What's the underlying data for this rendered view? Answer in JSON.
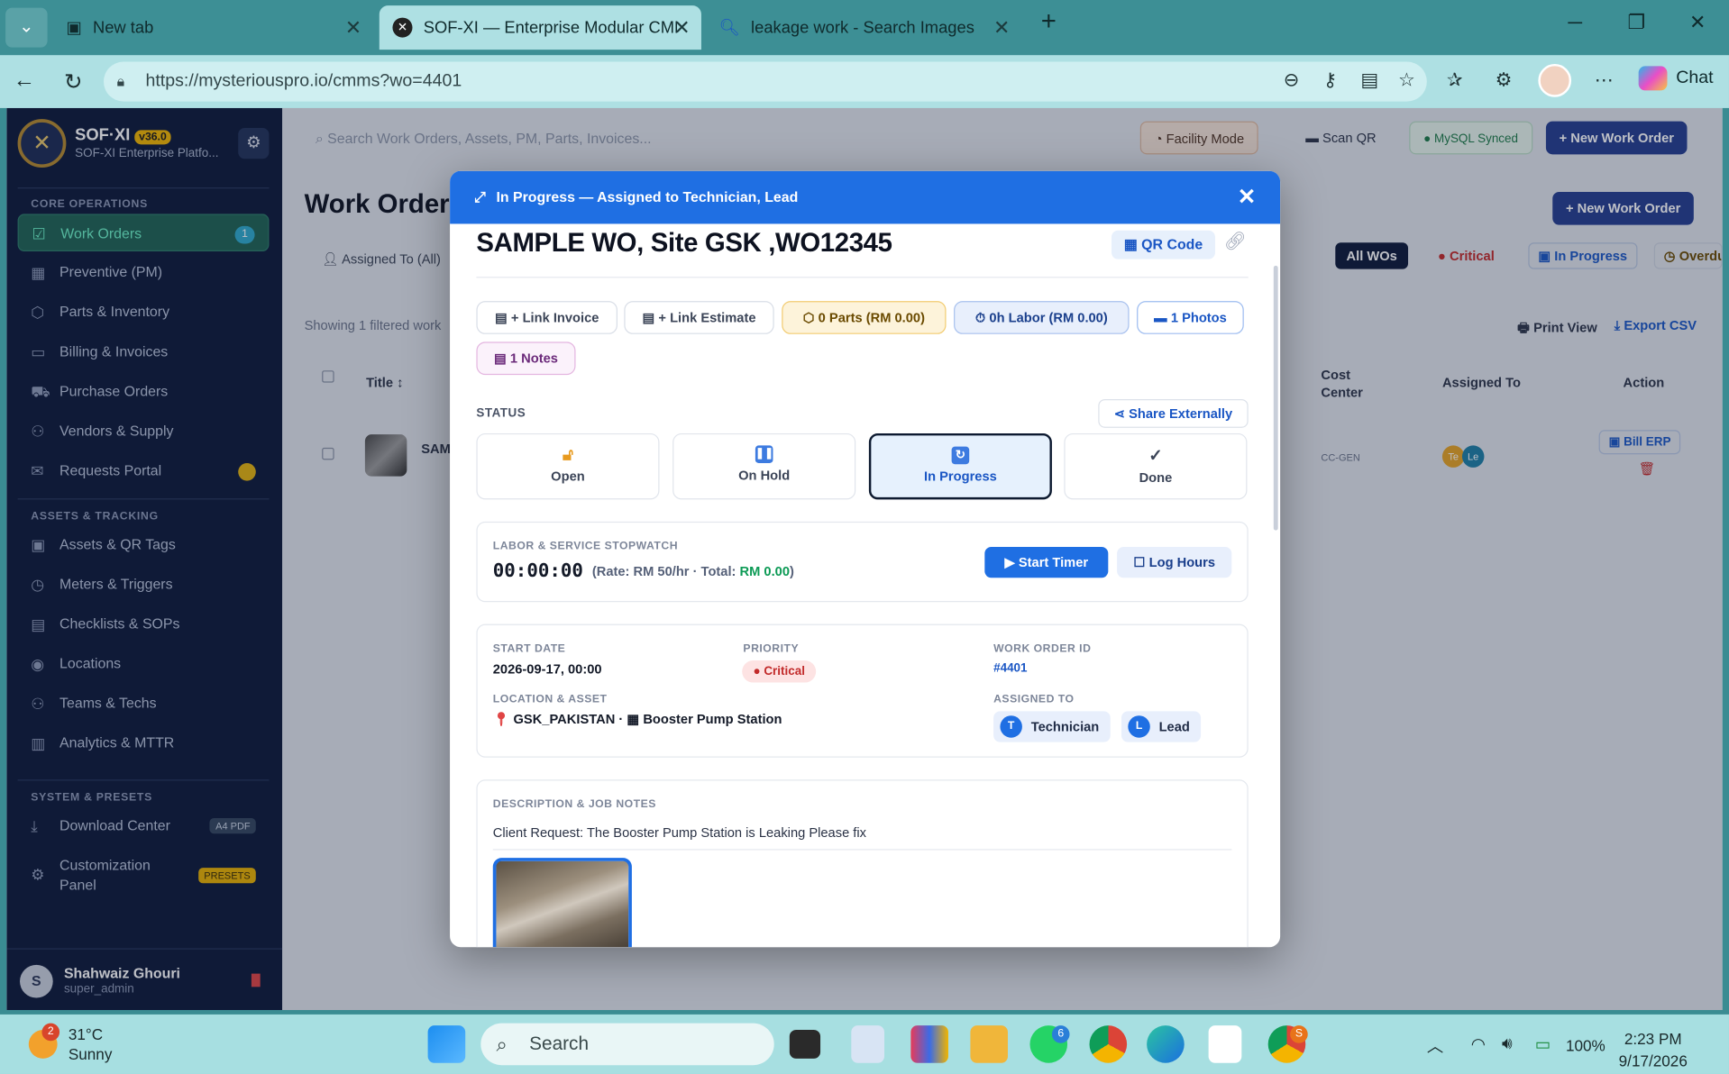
{
  "browser": {
    "tabs": [
      {
        "title": "New tab"
      },
      {
        "title": "SOF-XI — Enterprise Modular CMMS"
      },
      {
        "title": "leakage work - Search Images"
      }
    ],
    "url": "https://mysteriouspro.io/cmms?wo=4401",
    "chat_label": "Chat"
  },
  "app": {
    "brand": {
      "name": "SOF·XI",
      "version": "v36.0",
      "subtitle": "SOF-XI Enterprise Platfo..."
    },
    "search_placeholder": "Search Work Orders, Assets, PM, Parts, Invoices...",
    "topbar": {
      "facility_mode": "Facility Mode",
      "scan_qr": "Scan QR",
      "db_status": "MySQL Synced",
      "new_wo": "+ New Work Order"
    },
    "sidebar": {
      "sections": [
        {
          "title": "CORE OPERATIONS",
          "items": [
            {
              "label": "Work Orders",
              "icon": "clipboard-icon",
              "badge": "1",
              "active": true
            },
            {
              "label": "Preventive (PM)",
              "icon": "calendar-icon"
            },
            {
              "label": "Parts & Inventory",
              "icon": "box-icon"
            },
            {
              "label": "Billing & Invoices",
              "icon": "card-icon"
            },
            {
              "label": "Purchase Orders",
              "icon": "cart-icon"
            },
            {
              "label": "Vendors & Supply",
              "icon": "user-plus-icon"
            },
            {
              "label": "Requests Portal",
              "icon": "mail-icon",
              "dot": true
            }
          ]
        },
        {
          "title": "ASSETS & TRACKING",
          "items": [
            {
              "label": "Assets & QR Tags",
              "icon": "briefcase-icon"
            },
            {
              "label": "Meters & Triggers",
              "icon": "clock-icon"
            },
            {
              "label": "Checklists & SOPs",
              "icon": "checklist-icon"
            },
            {
              "label": "Locations",
              "icon": "pin-icon"
            },
            {
              "label": "Teams & Techs",
              "icon": "team-icon"
            },
            {
              "label": "Analytics & MTTR",
              "icon": "bar-chart-icon"
            }
          ]
        },
        {
          "title": "SYSTEM & PRESETS",
          "items": [
            {
              "label": "Download Center",
              "icon": "download-icon",
              "pill": "A4 PDF"
            },
            {
              "label": "Customization Panel",
              "icon": "gear-icon",
              "pill": "PRESETS"
            }
          ]
        }
      ]
    },
    "user": {
      "initial": "S",
      "name": "Shahwaiz Ghouri",
      "role": "super_admin"
    },
    "page": {
      "title": "Work Orders",
      "new_wo": "+ New Work Order",
      "filter_assigned": "Assigned To (All)",
      "quick_filters": [
        "All WOs",
        "Critical",
        "In Progress",
        "Overdue"
      ],
      "showing": "Showing 1 filtered work",
      "print": "Print View",
      "export": "Export CSV",
      "columns": {
        "title": "Title",
        "cost_center": "Cost Center",
        "assigned_to": "Assigned To",
        "action": "Action"
      },
      "row": {
        "title_short": "SAM",
        "cost_center": "CC-GEN",
        "bill_erp": "Bill ERP",
        "avatar_a": "Te",
        "avatar_b": "Le"
      }
    }
  },
  "modal": {
    "header": "In Progress — Assigned to Technician, Lead",
    "title": "SAMPLE WO, Site GSK ,WO12345",
    "qr_code": "QR Code",
    "chips": {
      "link_invoice": "+ Link Invoice",
      "link_estimate": "+ Link Estimate",
      "parts": "0 Parts (RM 0.00)",
      "labor": "0h Labor (RM 0.00)",
      "photos": "1 Photos",
      "notes": "1 Notes"
    },
    "status_label": "STATUS",
    "share": "Share Externally",
    "statuses": [
      {
        "label": "Open",
        "icon": "unlock-icon"
      },
      {
        "label": "On Hold",
        "icon": "pause-icon"
      },
      {
        "label": "In Progress",
        "icon": "refresh-icon",
        "selected": true
      },
      {
        "label": "Done",
        "icon": "check-icon"
      }
    ],
    "stopwatch": {
      "label": "LABOR & SERVICE STOPWATCH",
      "time": "00:00:00",
      "rate_text": "(Rate: RM 50/hr · Total:",
      "total": "RM 0.00",
      "rate_close": ")",
      "start": "Start Timer",
      "log": "Log Hours"
    },
    "details": {
      "start_date_label": "START DATE",
      "start_date": "2026-09-17, 00:00",
      "priority_label": "PRIORITY",
      "priority": "Critical",
      "woid_label": "WORK ORDER ID",
      "woid": "#4401",
      "location_label": "LOCATION & ASSET",
      "location": "GSK_PAKISTAN",
      "asset": "Booster Pump Station",
      "assigned_label": "ASSIGNED TO",
      "assignees": [
        {
          "initial": "T",
          "name": "Technician"
        },
        {
          "initial": "L",
          "name": "Lead"
        }
      ]
    },
    "description": {
      "label": "DESCRIPTION & JOB NOTES",
      "text": "Client Request: The Booster Pump Station is Leaking Please fix"
    }
  },
  "taskbar": {
    "weather": {
      "temp": "31°C",
      "text": "Sunny",
      "badge": "2"
    },
    "search": "Search",
    "battery": "100%",
    "time": "2:23 PM",
    "date": "9/17/2026",
    "whatsapp_badge": "6",
    "chrome_badge": "S"
  }
}
